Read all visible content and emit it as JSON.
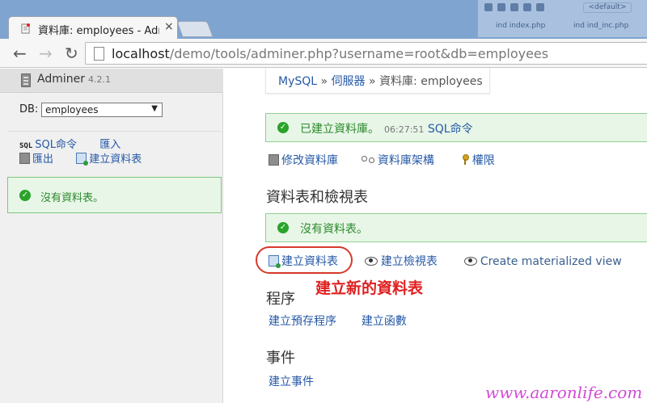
{
  "browser": {
    "tab_title": "資料庫: employees - Admi",
    "tab_close": "×",
    "new_tab_label": "",
    "back": "←",
    "forward": "→",
    "reload": "↻",
    "url_host": "localhost",
    "url_path": "/demo/tools/adminer.php?username=root&db=employees",
    "background_window": {
      "tag": "<default>",
      "file1": "ind  index.php",
      "file2": "ind  ind_inc.php"
    }
  },
  "sidebar": {
    "app_name": "Adminer",
    "version": "4.2.1",
    "db_label": "DB:",
    "db_selected": "employees",
    "links": {
      "sql_icon": "SQL",
      "sql_command": "SQL命令",
      "import": "匯入",
      "export": "匯出",
      "create_table": "建立資料表"
    },
    "message": "沒有資料表。"
  },
  "main": {
    "breadcrumb": {
      "mysql": "MySQL",
      "sep": "»",
      "server": "伺服器",
      "current": "資料庫: employees"
    },
    "created_message": {
      "text": "已建立資料庫。",
      "time": "06:27:51",
      "link": "SQL命令"
    },
    "db_links": {
      "alter": "修改資料庫",
      "schema": "資料庫架構",
      "privileges": "權限"
    },
    "tables_heading": "資料表和檢視表",
    "no_tables_message": "沒有資料表。",
    "table_links": {
      "create_table": "建立資料表",
      "create_view": "建立檢視表",
      "create_mview": "Create materialized view"
    },
    "routines_heading": "程序",
    "routine_links": {
      "create_procedure": "建立預存程序",
      "create_function": "建立函數"
    },
    "events_heading": "事件",
    "event_links": {
      "create_event": "建立事件"
    }
  },
  "annotation": "建立新的資料表",
  "watermark": "www.aaronlife.com",
  "colors": {
    "link": "#2659a6",
    "success_bg": "#e8f6e8",
    "success_text": "#2b8a2b",
    "annotation_red": "#e02020",
    "watermark": "#d24ad6"
  }
}
